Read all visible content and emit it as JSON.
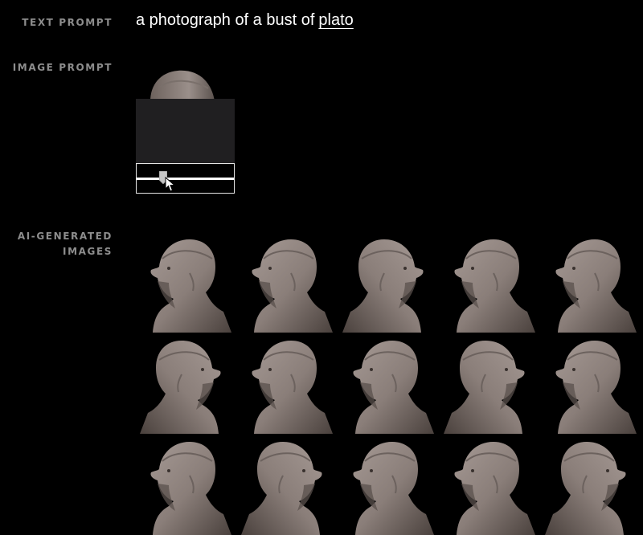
{
  "labels": {
    "text_prompt": "TEXT PROMPT",
    "image_prompt": "IMAGE PROMPT",
    "generated_line1": "AI-GENERATED",
    "generated_line2": "IMAGES"
  },
  "prompt": {
    "prefix": "a photograph of a bust of",
    "subject": "plato"
  },
  "slider": {
    "value": 0.25
  },
  "colors": {
    "background": "#000000",
    "label": "#8d8d8d",
    "panel": "#201f21",
    "stone": "#8a7e79"
  },
  "images": [
    {
      "name": "generated-image-1"
    },
    {
      "name": "generated-image-2"
    },
    {
      "name": "generated-image-3"
    },
    {
      "name": "generated-image-4"
    },
    {
      "name": "generated-image-5"
    },
    {
      "name": "generated-image-6"
    },
    {
      "name": "generated-image-7"
    },
    {
      "name": "generated-image-8"
    },
    {
      "name": "generated-image-9"
    },
    {
      "name": "generated-image-10"
    },
    {
      "name": "generated-image-11"
    },
    {
      "name": "generated-image-12"
    },
    {
      "name": "generated-image-13"
    },
    {
      "name": "generated-image-14"
    },
    {
      "name": "generated-image-15"
    }
  ]
}
